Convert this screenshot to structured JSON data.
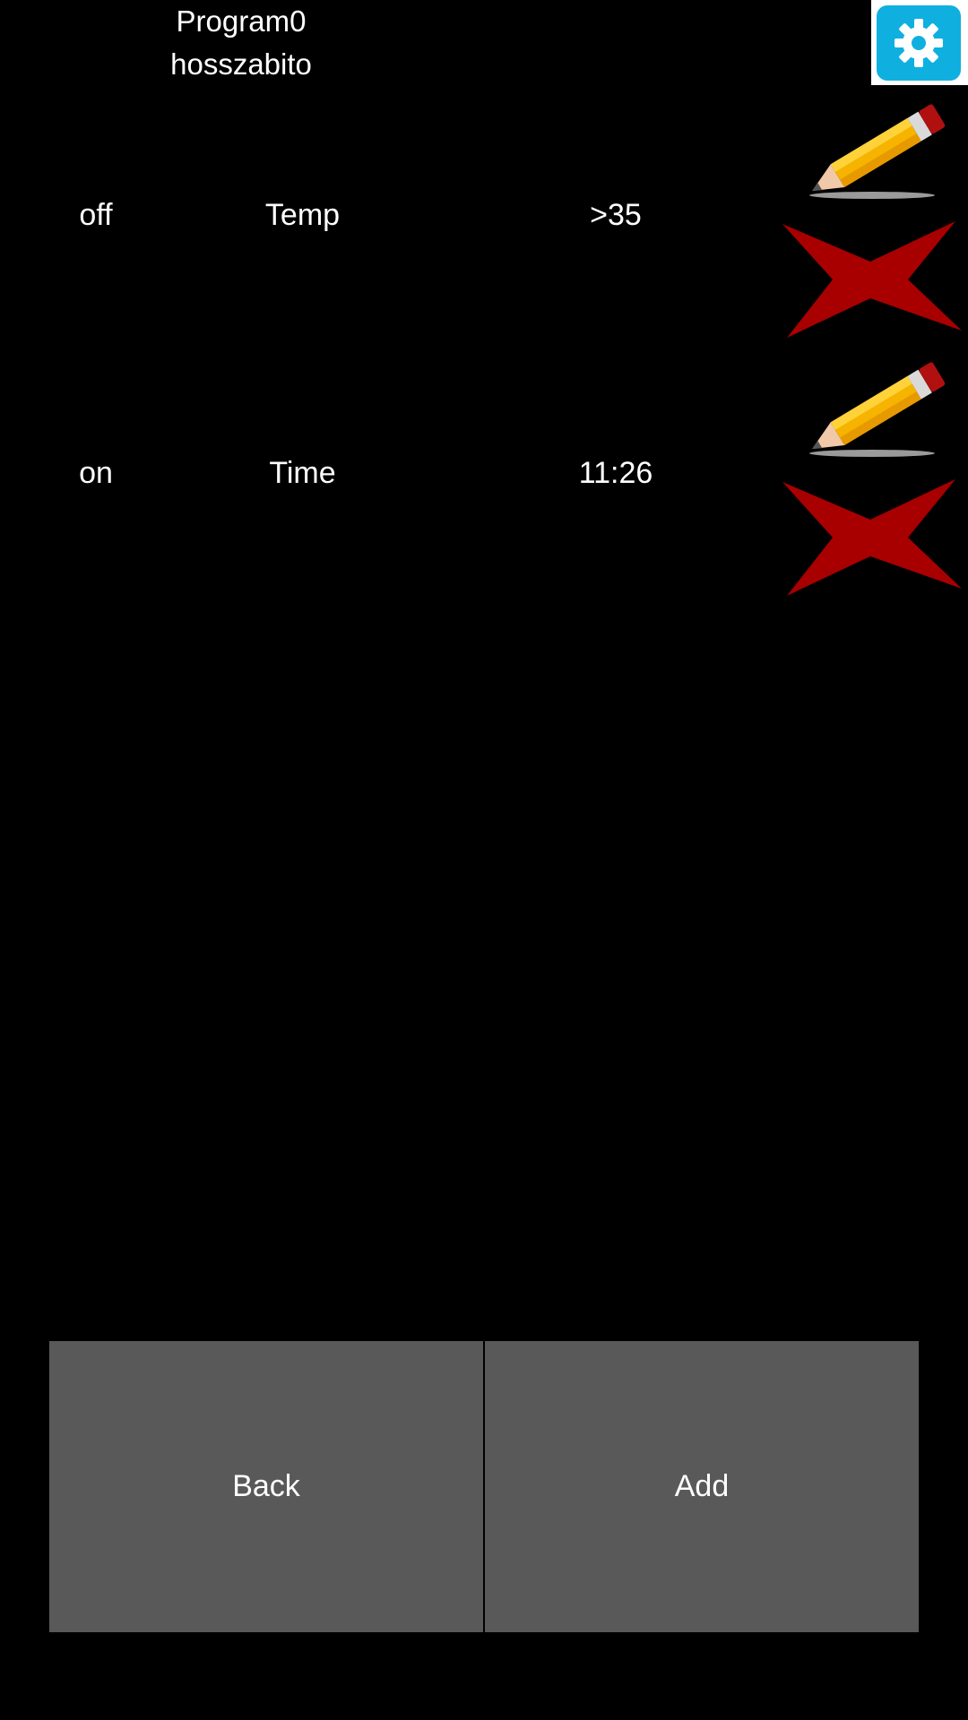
{
  "header": {
    "program_name": "Program0",
    "program_subtitle": "hosszabito",
    "settings_icon": "gear-icon",
    "settings_color": "#0fb0e0"
  },
  "rules": [
    {
      "state": "off",
      "type": "Temp",
      "value": ">35",
      "edit_icon": "pencil-icon",
      "delete_icon": "red-x-icon"
    },
    {
      "state": "on",
      "type": "Time",
      "value": "11:26",
      "edit_icon": "pencil-icon",
      "delete_icon": "red-x-icon"
    }
  ],
  "footer": {
    "back_label": "Back",
    "add_label": "Add",
    "button_color": "#595959"
  }
}
